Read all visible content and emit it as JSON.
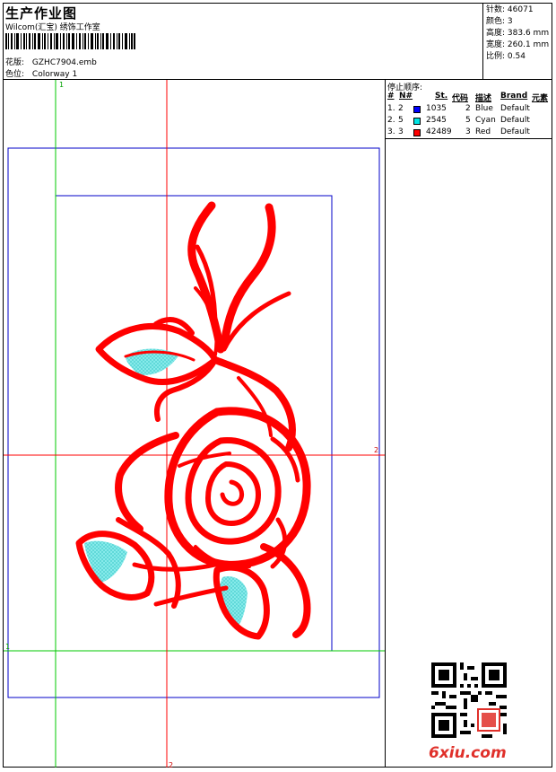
{
  "header": {
    "title": "生产作业图",
    "subtitle": "Wilcom(汇宝) 绣饰工作室",
    "design_label": "花版:",
    "design_value": "GZHC7904.emb",
    "colorway_label": "色位:",
    "colorway_value": "Colorway 1"
  },
  "stats": [
    {
      "label": "针数:",
      "value": "46071"
    },
    {
      "label": "颜色:",
      "value": "3"
    },
    {
      "label": "高度:",
      "value": "383.6 mm"
    },
    {
      "label": "宽度:",
      "value": "260.1 mm"
    },
    {
      "label": "比例:",
      "value": "0.54"
    }
  ],
  "stop_sequence": {
    "title": "停止顺序:",
    "columns": [
      "#",
      "N#",
      "St.",
      "代码",
      "描述",
      "Brand",
      "元素"
    ],
    "rows": [
      {
        "idx": "1.",
        "n": "2",
        "stitches": "1035",
        "code": "2",
        "desc": "Blue",
        "brand": "Default",
        "color": "#0000ff"
      },
      {
        "idx": "2.",
        "n": "5",
        "stitches": "2545",
        "code": "5",
        "desc": "Cyan",
        "brand": "Default",
        "color": "#00e5e5"
      },
      {
        "idx": "3.",
        "n": "3",
        "stitches": "42489",
        "code": "3",
        "desc": "Red",
        "brand": "Default",
        "color": "#ff0000"
      }
    ]
  },
  "guides": {
    "marker_1_top": "1",
    "marker_1_left": "1",
    "marker_2_right": "2",
    "marker_2_bottom": "2"
  },
  "colors": {
    "red": "#ff0000",
    "cyan": "#7fe8e8",
    "blue": "#0000c8",
    "green": "#00c800"
  },
  "watermark": "6xiu.com"
}
